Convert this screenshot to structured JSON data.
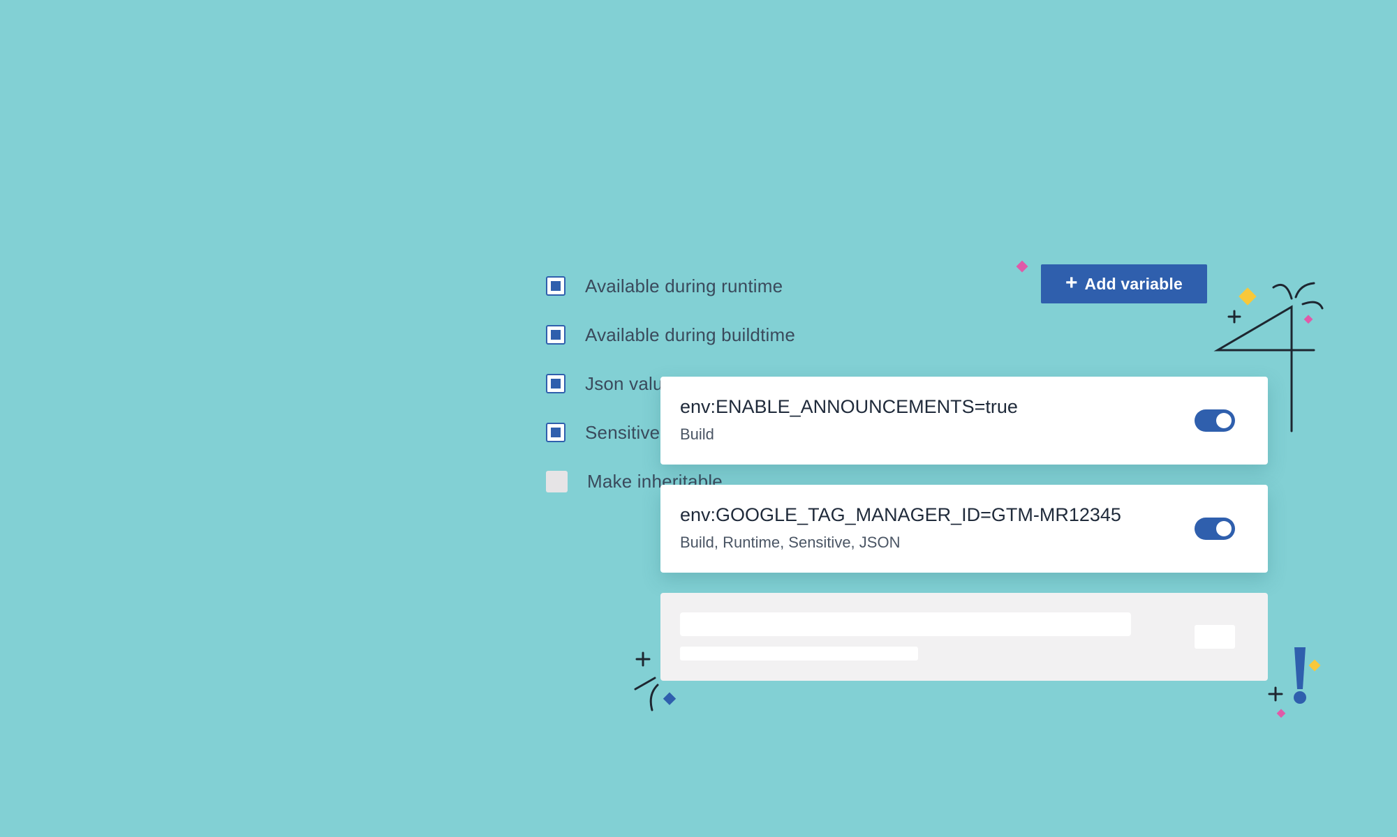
{
  "colors": {
    "background": "#82d0d4",
    "accent": "#2f5fad",
    "pink": "#e05aa8",
    "yellow": "#f8c83a",
    "ink": "#1e2630"
  },
  "options": [
    {
      "label": "Available during runtime",
      "checked": true
    },
    {
      "label": "Available during buildtime",
      "checked": true
    },
    {
      "label": "Json value",
      "checked": true
    },
    {
      "label": "Sensitive",
      "checked": true
    },
    {
      "label": "Make inheritable",
      "checked": false
    }
  ],
  "add_button": {
    "icon": "plus-icon",
    "label": "Add variable"
  },
  "variables": [
    {
      "name": "env:ENABLE_ANNOUNCEMENTS=true",
      "scope": "Build",
      "enabled": true
    },
    {
      "name": "env:GOOGLE_TAG_MANAGER_ID=GTM-MR12345",
      "scope": "Build, Runtime, Sensitive, JSON",
      "enabled": true
    }
  ]
}
